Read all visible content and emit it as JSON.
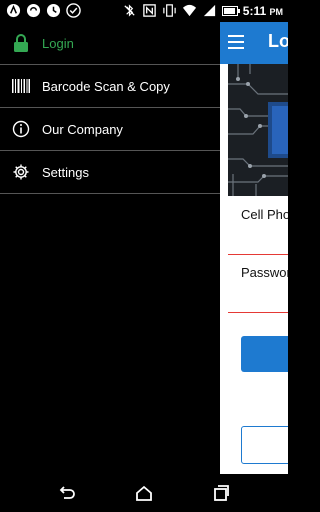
{
  "status_bar": {
    "time": "5:11",
    "ampm": "PM"
  },
  "app": {
    "title": "Login",
    "cell_phone_label": "Cell Phone",
    "password_label": "Password"
  },
  "drawer": {
    "items": [
      {
        "label": "Login",
        "icon": "lock-icon",
        "active": true
      },
      {
        "label": "Barcode Scan & Copy",
        "icon": "barcode-icon",
        "active": false
      },
      {
        "label": "Our Company",
        "icon": "info-icon",
        "active": false
      },
      {
        "label": "Settings",
        "icon": "gear-icon",
        "active": false
      }
    ]
  },
  "colors": {
    "accent": "#1e7ad0",
    "active_item": "#34a853",
    "error_line": "#e53935"
  }
}
